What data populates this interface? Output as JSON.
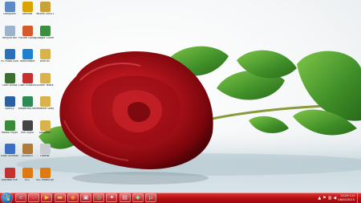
{
  "desktop": {
    "icons": [
      {
        "label": "Computer",
        "icon": "computer-icon",
        "color": "#5d89c4"
      },
      {
        "label": "AkelPad",
        "icon": "notepad-icon",
        "color": "#d9a400"
      },
      {
        "label": "Yardım Sonu Destek",
        "icon": "help-icon",
        "color": "#c9a23a"
      },
      {
        "label": "Recycle Bin",
        "icon": "recycle-bin-icon",
        "color": "#9bb4cc"
      },
      {
        "label": "Picture Collage",
        "icon": "collage-icon",
        "color": "#d45a2e"
      },
      {
        "label": "Google Chrome",
        "icon": "chrome-icon",
        "color": "#3e8e41"
      },
      {
        "label": "PS Photo Suite",
        "icon": "photo-suite-icon",
        "color": "#2a6fb8"
      },
      {
        "label": "TeamViewer",
        "icon": "teamviewer-icon",
        "color": "#1f7fd1"
      },
      {
        "label": "bnet dll",
        "icon": "folder-icon",
        "color": "#d8b24a"
      },
      {
        "label": "Corel DRAW",
        "icon": "corel-icon",
        "color": "#3c6e2f"
      },
      {
        "label": "Flash Installer",
        "icon": "flash-icon",
        "color": "#c72e2e"
      },
      {
        "label": "Sistem Yedek",
        "icon": "folder-icon",
        "color": "#d8b24a"
      },
      {
        "label": "Speccy",
        "icon": "speccy-icon",
        "color": "#2b5f9e"
      },
      {
        "label": "Kaspersky Recovery",
        "icon": "kaspersky-icon",
        "color": "#2d8a57"
      },
      {
        "label": "Yedekler Dosyası",
        "icon": "folder-icon",
        "color": "#d8b24a"
      },
      {
        "label": "Media Player",
        "icon": "media-icon",
        "color": "#3a8a3a"
      },
      {
        "label": "Film Arşivi",
        "icon": "film-icon",
        "color": "#444444"
      },
      {
        "label": "Dosyalar",
        "icon": "folder-icon",
        "color": "#d8b24a"
      },
      {
        "label": "IObit Uninstaller",
        "icon": "uninstaller-icon",
        "color": "#3a6fc4"
      },
      {
        "label": "Kullanıcı",
        "icon": "user-icon",
        "color": "#b07a3a"
      },
      {
        "label": "Format",
        "icon": "format-icon",
        "color": "#c8ccd0"
      },
      {
        "label": "Anydesk PDF",
        "icon": "anydesk-icon",
        "color": "#c23030"
      },
      {
        "label": "VLC",
        "icon": "vlc-icon",
        "color": "#e07a10"
      },
      {
        "label": "VLC media player",
        "icon": "vlc-icon",
        "color": "#e07a10"
      }
    ]
  },
  "taskbar": {
    "start_label": "Start",
    "pinned": [
      {
        "name": "ie-icon",
        "glyph": "e",
        "color": "#7ec8ff"
      },
      {
        "name": "opera-icon",
        "glyph": "O",
        "color": "#ff5555"
      },
      {
        "name": "media-player-icon",
        "glyph": "▶",
        "color": "#ffcc33"
      },
      {
        "name": "folder-icon",
        "glyph": "▬",
        "color": "#f3c94d"
      },
      {
        "name": "firefox-icon",
        "glyph": "◉",
        "color": "#ff9a2e"
      },
      {
        "name": "window-icon",
        "glyph": "▣",
        "color": "#cfe6ff"
      },
      {
        "name": "chrome-icon",
        "glyph": "◎",
        "color": "#7be07b"
      },
      {
        "name": "app-icon",
        "glyph": "✦",
        "color": "#ffffff"
      },
      {
        "name": "monitor-icon",
        "glyph": "▤",
        "color": "#dfe9f5"
      },
      {
        "name": "shield-icon",
        "glyph": "◆",
        "color": "#8ee38e"
      },
      {
        "name": "utorrent-icon",
        "glyph": "µ",
        "color": "#9be29b"
      }
    ],
    "clock_time": "13:29 C.H",
    "clock_date": "08/05/2015",
    "tray_icons": [
      "flag-icon",
      "network-icon",
      "volume-icon"
    ]
  }
}
